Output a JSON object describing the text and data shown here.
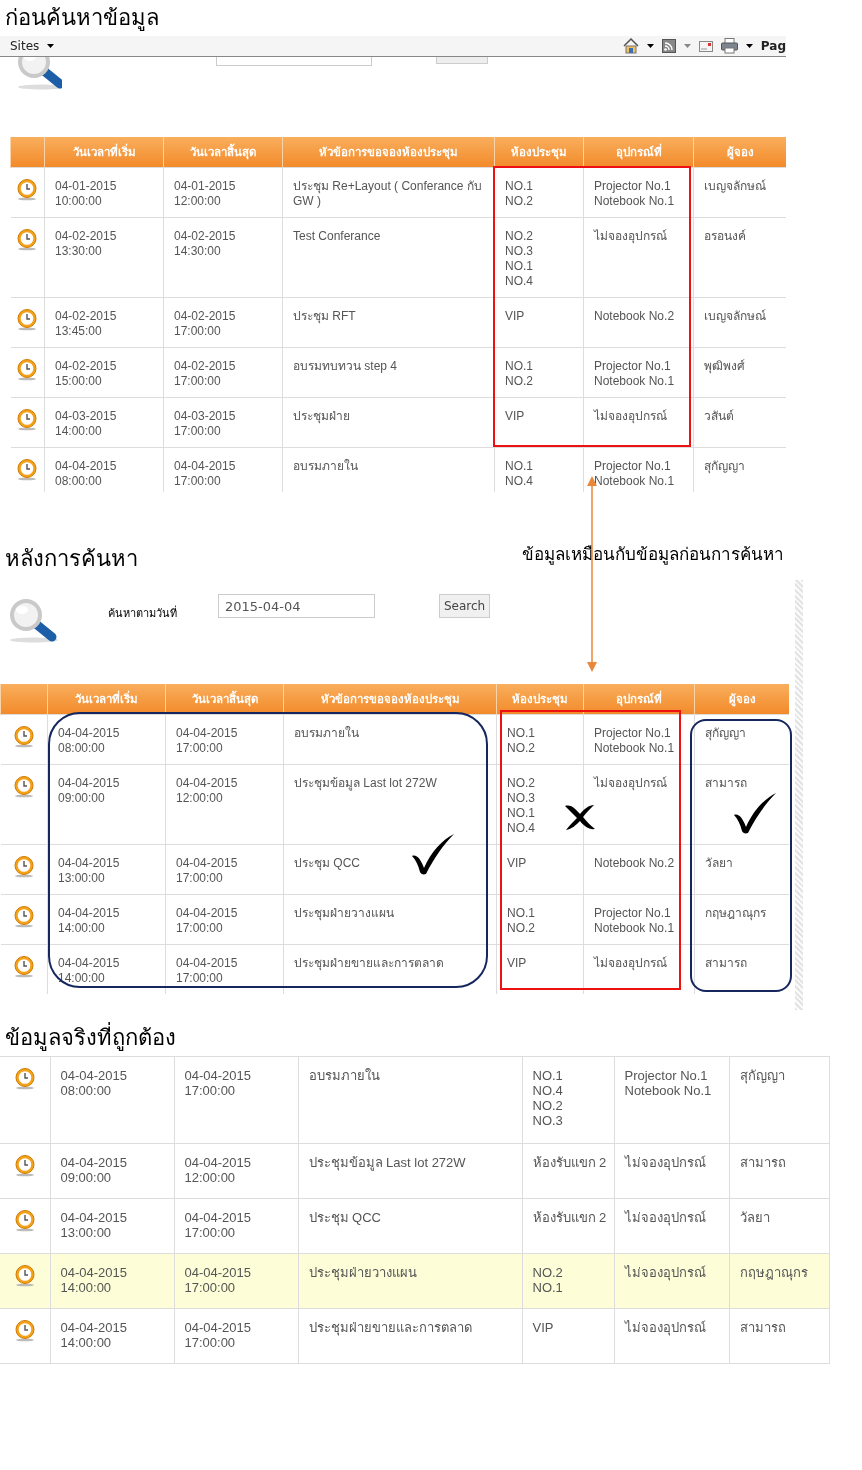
{
  "sections": [
    {
      "kind": "before",
      "title": "ก่อนค้นหาข้อมูล",
      "toolbar": {
        "left_label": "Sites",
        "right_label": "Pag"
      },
      "search": {
        "kind": "covered"
      },
      "table": {
        "header": true,
        "columns": [
          "วันเวลาที่เริ่ม",
          "วันเวลาสิ้นสุด",
          "หัวข้อการขอจองห้องประชุม",
          "ห้องประชุม",
          "อุปกรณ์ที่",
          "ผู้จอง"
        ],
        "rows": [
          {
            "start": "04-01-2015\n10:00:00",
            "end": "04-01-2015\n12:00:00",
            "subject": "ประชุม Re+Layout ( Conferance กับ GW )",
            "room": "NO.1\nNO.2",
            "equipment": "Projector No.1\nNotebook No.1",
            "booker": "เบญจลักษณ์"
          },
          {
            "start": "04-02-2015\n13:30:00",
            "end": "04-02-2015\n14:30:00",
            "subject": "Test Conferance",
            "room": "NO.2\nNO.3\nNO.1\nNO.4",
            "equipment": "ไม่จองอุปกรณ์",
            "booker": "อรอนงค์"
          },
          {
            "start": "04-02-2015\n13:45:00",
            "end": "04-02-2015\n17:00:00",
            "subject": "ประชุม RFT",
            "room": "VIP",
            "equipment": "Notebook No.2",
            "booker": "เบญจลักษณ์"
          },
          {
            "start": "04-02-2015\n15:00:00",
            "end": "04-02-2015\n17:00:00",
            "subject": "อบรมทบทวน step 4",
            "room": "NO.1\nNO.2",
            "equipment": "Projector No.1\nNotebook No.1",
            "booker": "พุฒิพงศ์"
          },
          {
            "start": "04-03-2015\n14:00:00",
            "end": "04-03-2015\n17:00:00",
            "subject": "ประชุมฝ่าย",
            "room": "VIP",
            "equipment": "ไม่จองอุปกรณ์",
            "booker": "วสันต์"
          },
          {
            "start": "04-04-2015\n08:00:00",
            "end": "04-04-2015\n17:00:00",
            "subject": "อบรมภายใน",
            "room": "NO.1\nNO.4",
            "equipment": "Projector No.1\nNotebook No.1",
            "booker": "สุกัญญา"
          }
        ]
      },
      "boxes": [
        {
          "kind": "plain"
        }
      ]
    },
    {
      "kind": "after",
      "title": "หลังการค้นหา",
      "note": "ข้อมูลเหมือนกับข้อมูลก่อนการค้นหา",
      "search": {
        "kind": "form",
        "label": "ค้นหาตามวันที่",
        "value": "2015-04-04",
        "button": "Search"
      },
      "table": {
        "header": true,
        "columns": [
          "วันเวลาที่เริ่ม",
          "วันเวลาสิ้นสุด",
          "หัวข้อการขอจองห้องประชุม",
          "ห้องประชุม",
          "อุปกรณ์ที่",
          "ผู้จอง"
        ],
        "rows": [
          {
            "start": "04-04-2015\n08:00:00",
            "end": "04-04-2015\n17:00:00",
            "subject": "อบรมภายใน",
            "room": "NO.1\nNO.2",
            "equipment": "Projector No.1\nNotebook No.1",
            "booker": "สุกัญญา"
          },
          {
            "start": "04-04-2015\n09:00:00",
            "end": "04-04-2015\n12:00:00",
            "subject": "ประชุมข้อมูล Last lot 272W",
            "room": "NO.2\nNO.3\nNO.1\nNO.4",
            "equipment": "ไม่จองอุปกรณ์",
            "booker": "สามารถ"
          },
          {
            "start": "04-04-2015\n13:00:00",
            "end": "04-04-2015\n17:00:00",
            "subject": "ประชุม QCC",
            "room": "VIP",
            "equipment": "Notebook No.2",
            "booker": "วัลยา"
          },
          {
            "start": "04-04-2015\n14:00:00",
            "end": "04-04-2015\n17:00:00",
            "subject": "ประชุมฝ่ายวางแผน",
            "room": "NO.1\nNO.2",
            "equipment": "Projector No.1\nNotebook No.1",
            "booker": "กฤษฎาณุกร"
          },
          {
            "start": "04-04-2015\n14:00:00",
            "end": "04-04-2015\n17:00:00",
            "subject": "ประชุมฝ่ายขายและการตลาด",
            "room": "VIP",
            "equipment": "ไม่จองอุปกรณ์",
            "booker": "สามารถ"
          }
        ]
      },
      "boxes": [
        {
          "kind": "check"
        },
        {
          "kind": "cross"
        },
        {
          "kind": "check"
        }
      ]
    },
    {
      "kind": "correct",
      "title": "ข้อมูลจริงที่ถูกต้อง",
      "table": {
        "header": false,
        "rows": [
          {
            "start": "04-04-2015\n08:00:00",
            "end": "04-04-2015\n17:00:00",
            "subject": "อบรมภายใน",
            "room": "NO.1\nNO.4\nNO.2\nNO.3",
            "equipment": "Projector No.1\nNotebook No.1",
            "booker": "สุกัญญา",
            "highlighted": false
          },
          {
            "start": "04-04-2015\n09:00:00",
            "end": "04-04-2015\n12:00:00",
            "subject": "ประชุมข้อมูล Last lot 272W",
            "room": "ห้องรับแขก 2",
            "equipment": "ไม่จองอุปกรณ์",
            "booker": "สามารถ",
            "highlighted": false
          },
          {
            "start": "04-04-2015\n13:00:00",
            "end": "04-04-2015\n17:00:00",
            "subject": "ประชุม QCC",
            "room": "ห้องรับแขก 2",
            "equipment": "ไม่จองอุปกรณ์",
            "booker": "วัลยา",
            "highlighted": false
          },
          {
            "start": "04-04-2015\n14:00:00",
            "end": "04-04-2015\n17:00:00",
            "subject": "ประชุมฝ่ายวางแผน",
            "room": "NO.2\nNO.1",
            "equipment": "ไม่จองอุปกรณ์",
            "booker": "กฤษฎาณุกร",
            "highlighted": true
          },
          {
            "start": "04-04-2015\n14:00:00",
            "end": "04-04-2015\n17:00:00",
            "subject": "ประชุมฝ่ายขายและการตลาด",
            "room": "VIP",
            "equipment": "ไม่จองอุปกรณ์",
            "booker": "สามารถ",
            "highlighted": false
          }
        ]
      }
    }
  ]
}
